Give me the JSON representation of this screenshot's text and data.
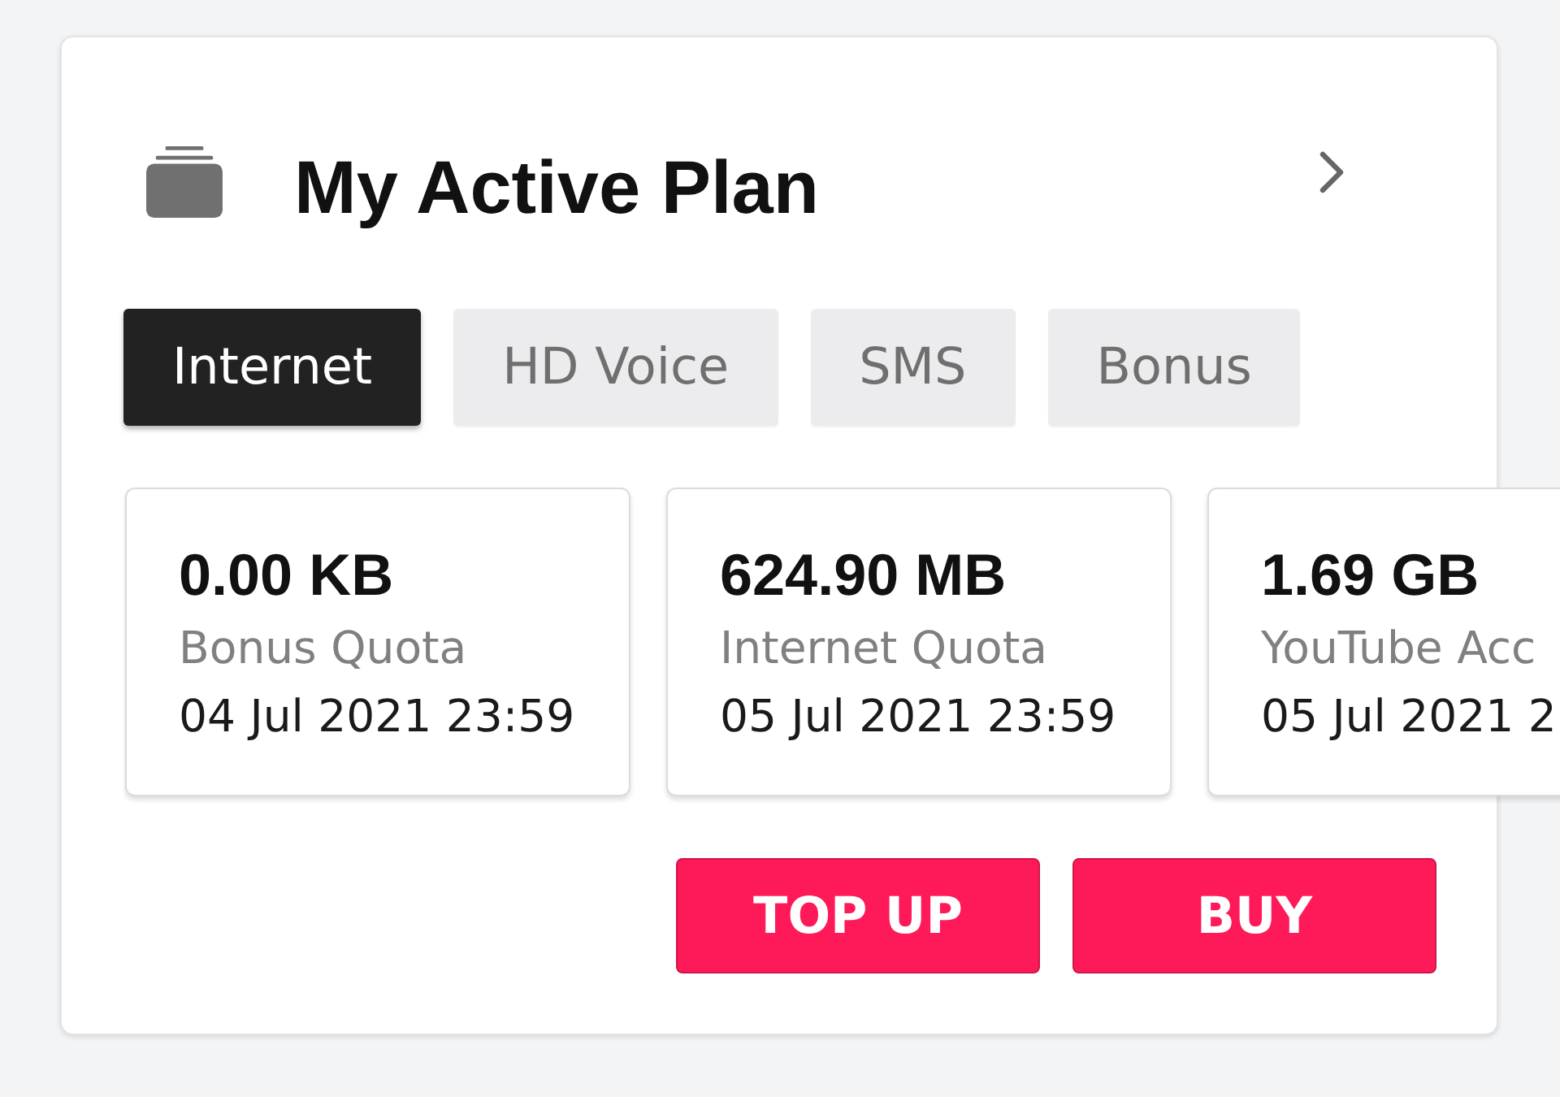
{
  "header": {
    "title": "My Active Plan"
  },
  "tabs": [
    {
      "label": "Internet",
      "selected": true
    },
    {
      "label": "HD Voice",
      "selected": false
    },
    {
      "label": "SMS",
      "selected": false
    },
    {
      "label": "Bonus",
      "selected": false
    }
  ],
  "quotas": [
    {
      "amount": "0.00 KB",
      "name": "Bonus Quota",
      "expiry": "04 Jul 2021 23:59"
    },
    {
      "amount": "624.90 MB",
      "name": "Internet Quota",
      "expiry": "05 Jul 2021 23:59"
    },
    {
      "amount": "1.69 GB",
      "name": "YouTube Acc",
      "expiry": "05 Jul 2021 2"
    }
  ],
  "actions": [
    "TOP UP",
    "BUY"
  ]
}
